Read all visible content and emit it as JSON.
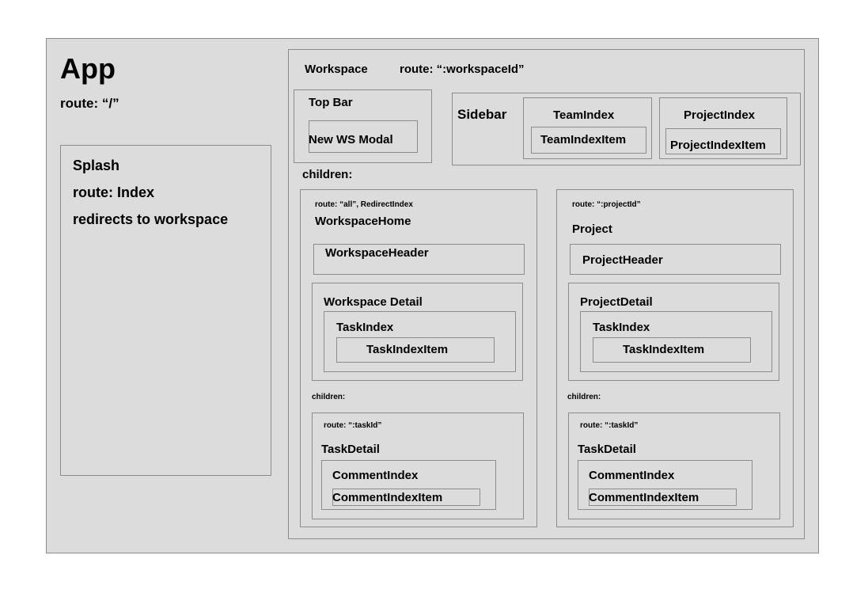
{
  "app": {
    "title": "App",
    "route": "route: “/”"
  },
  "splash": {
    "title": "Splash",
    "route": "route: Index",
    "note": "redirects to workspace"
  },
  "workspace": {
    "title": "Workspace",
    "route": "route: “:workspaceId”",
    "top_bar": {
      "title": "Top Bar",
      "modal": "New WS Modal"
    },
    "sidebar": {
      "title": "Sidebar",
      "team_index": "TeamIndex",
      "team_index_item": "TeamIndexItem",
      "project_index": "ProjectIndex",
      "project_index_item": "ProjectIndexItem"
    },
    "children_label": "children:"
  },
  "workspace_home": {
    "route": "route:  “all”, RedirectIndex",
    "title": "WorkspaceHome",
    "header": "WorkspaceHeader",
    "detail": "Workspace Detail",
    "task_index": "TaskIndex",
    "task_index_item": "TaskIndexItem",
    "children_label": "children:",
    "task_detail": {
      "route": "route: “:taskId”",
      "title": "TaskDetail",
      "comment_index": "CommentIndex",
      "comment_index_item": "CommentIndexItem"
    }
  },
  "project": {
    "route": "route: “:projectId”",
    "title": "Project",
    "header": "ProjectHeader",
    "detail": "ProjectDetail",
    "task_index": "TaskIndex",
    "task_index_item": "TaskIndexItem",
    "children_label": "children:",
    "task_detail": {
      "route": "route: “:taskId”",
      "title": "TaskDetail",
      "comment_index": "CommentIndex",
      "comment_index_item": "CommentIndexItem"
    }
  }
}
